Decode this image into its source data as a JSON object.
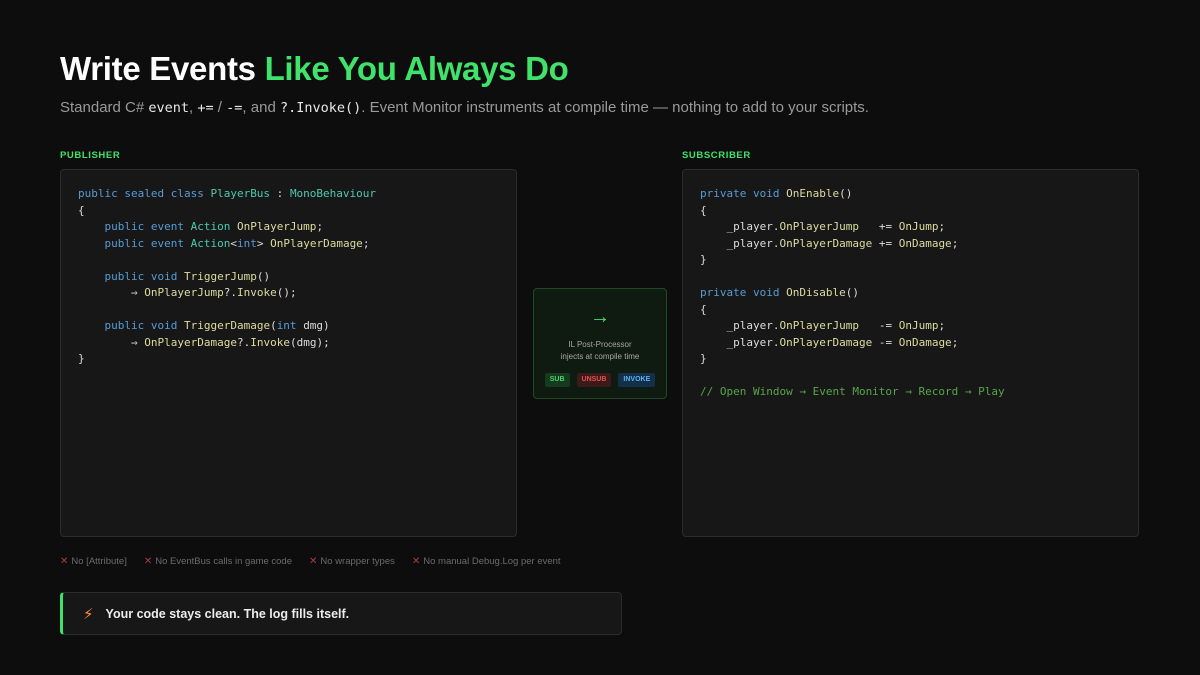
{
  "title": {
    "part1": "Write Events ",
    "accent": "Like You Always Do"
  },
  "subtitle": {
    "t1": "Standard C# ",
    "c1": "event",
    "t2": ", ",
    "c2": "+=",
    "t3": " / ",
    "c3": "-=",
    "t4": ", and ",
    "c4": "?.Invoke()",
    "t5": ". Event Monitor instruments at compile time — nothing to add to your scripts."
  },
  "publisher": {
    "label": "PUBLISHER",
    "lines": [
      [
        [
          "kw",
          "public sealed class "
        ],
        [
          "ty",
          "PlayerBus"
        ],
        [
          "pl",
          " : "
        ],
        [
          "ty",
          "MonoBehaviour"
        ]
      ],
      [
        [
          "pl",
          "{"
        ]
      ],
      [
        [
          "kw",
          "    public event "
        ],
        [
          "ty",
          "Action "
        ],
        [
          "fn",
          "OnPlayerJump"
        ],
        [
          "pl",
          ";"
        ]
      ],
      [
        [
          "kw",
          "    public event "
        ],
        [
          "ty",
          "Action"
        ],
        [
          "pl",
          "<"
        ],
        [
          "kw",
          "int"
        ],
        [
          "pl",
          "> "
        ],
        [
          "fn",
          "OnPlayerDamage"
        ],
        [
          "pl",
          ";"
        ]
      ],
      [],
      [
        [
          "kw",
          "    public void "
        ],
        [
          "fn",
          "TriggerJump"
        ],
        [
          "pl",
          "()"
        ]
      ],
      [
        [
          "pl",
          "        ⇒ "
        ],
        [
          "fn",
          "OnPlayerJump"
        ],
        [
          "pl",
          "?."
        ],
        [
          "fn",
          "Invoke"
        ],
        [
          "pl",
          "();"
        ]
      ],
      [],
      [
        [
          "kw",
          "    public void "
        ],
        [
          "fn",
          "TriggerDamage"
        ],
        [
          "pl",
          "("
        ],
        [
          "kw",
          "int "
        ],
        [
          "pl",
          "dmg)"
        ]
      ],
      [
        [
          "pl",
          "        ⇒ "
        ],
        [
          "fn",
          "OnPlayerDamage"
        ],
        [
          "pl",
          "?."
        ],
        [
          "fn",
          "Invoke"
        ],
        [
          "pl",
          "(dmg);"
        ]
      ],
      [
        [
          "pl",
          "}"
        ]
      ]
    ]
  },
  "subscriber": {
    "label": "SUBSCRIBER",
    "lines": [
      [
        [
          "kw",
          "private void "
        ],
        [
          "fn",
          "OnEnable"
        ],
        [
          "pl",
          "()"
        ]
      ],
      [
        [
          "pl",
          "{"
        ]
      ],
      [
        [
          "pl",
          "    _player."
        ],
        [
          "fn",
          "OnPlayerJump"
        ],
        [
          "pl",
          "   += "
        ],
        [
          "fn",
          "OnJump"
        ],
        [
          "pl",
          ";"
        ]
      ],
      [
        [
          "pl",
          "    _player."
        ],
        [
          "fn",
          "OnPlayerDamage"
        ],
        [
          "pl",
          " += "
        ],
        [
          "fn",
          "OnDamage"
        ],
        [
          "pl",
          ";"
        ]
      ],
      [
        [
          "pl",
          "}"
        ]
      ],
      [],
      [
        [
          "kw",
          "private void "
        ],
        [
          "fn",
          "OnDisable"
        ],
        [
          "pl",
          "()"
        ]
      ],
      [
        [
          "pl",
          "{"
        ]
      ],
      [
        [
          "pl",
          "    _player."
        ],
        [
          "fn",
          "OnPlayerJump"
        ],
        [
          "pl",
          "   -= "
        ],
        [
          "fn",
          "OnJump"
        ],
        [
          "pl",
          ";"
        ]
      ],
      [
        [
          "pl",
          "    _player."
        ],
        [
          "fn",
          "OnPlayerDamage"
        ],
        [
          "pl",
          " -= "
        ],
        [
          "fn",
          "OnDamage"
        ],
        [
          "pl",
          ";"
        ]
      ],
      [
        [
          "pl",
          "}"
        ]
      ],
      [],
      [
        [
          "cm",
          "// Open Window → Event Monitor → Record → Play"
        ]
      ]
    ]
  },
  "processor": {
    "arrow": "→",
    "line1": "IL Post-Processor",
    "line2": "injects at compile time",
    "pills": {
      "sub": "SUB",
      "unsub": "UNSUB",
      "invoke": "INVOKE"
    }
  },
  "nopes": [
    "No [Attribute]",
    "No EventBus calls in game code",
    "No wrapper types",
    "No manual Debug.Log per event"
  ],
  "nope_icon": "✕",
  "callout": {
    "icon": "⚡",
    "text": "Your code stays clean. The log fills itself."
  },
  "colors": {
    "accent": "#3fe36b",
    "background": "#0d0d0d",
    "keyword": "#569cd6",
    "type": "#4ec9b0",
    "method": "#dcdca0",
    "comment": "#57a64a"
  }
}
